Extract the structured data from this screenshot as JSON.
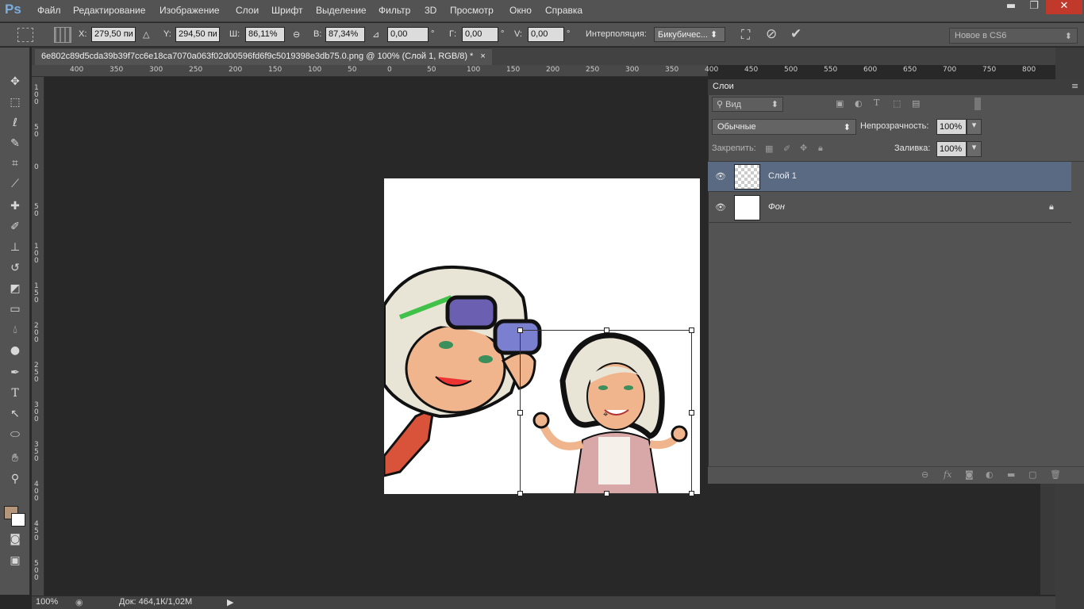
{
  "app": {
    "logo": "Ps"
  },
  "menu": [
    "Файл",
    "Редактирование",
    "Изображение",
    "Слои",
    "Шрифт",
    "Выделение",
    "Фильтр",
    "3D",
    "Просмотр",
    "Окно",
    "Справка"
  ],
  "window_controls": {
    "minimize": "▬",
    "restore": "❐",
    "close": "✕"
  },
  "options": {
    "x_label": "X:",
    "x_value": "279,50 пи",
    "y_label": "Y:",
    "y_value": "294,50 пи",
    "w_label": "Ш:",
    "w_value": "86,11%",
    "h_label": "В:",
    "h_value": "87,34%",
    "angle_value": "0,00",
    "angle_unit": "°",
    "hskew_label": "Г:",
    "hskew_value": "0,00",
    "hskew_unit": "°",
    "vskew_label": "V:",
    "vskew_value": "0,00",
    "vskew_unit": "°",
    "interp_label": "Интерполяция:",
    "interp_value": "Бикубичес...",
    "workspace": "Новое в CS6"
  },
  "document_tab": {
    "title": "6e802c89d5cda39b39f7cc6e18ca7070a063f02d00596fd6f9c5019398e3db75.0.png @ 100% (Слой 1, RGB/8) *",
    "close": "×"
  },
  "ruler_top": [
    "400",
    "350",
    "300",
    "250",
    "200",
    "150",
    "100",
    "50",
    "0",
    "50",
    "100",
    "150",
    "200",
    "250",
    "300",
    "350",
    "400",
    "450",
    "500",
    "550",
    "600",
    "650",
    "700",
    "750",
    "800",
    "850"
  ],
  "ruler_left": [
    "1 0 0",
    "5 0",
    "0",
    "5 0",
    "1 0 0",
    "1 5 0",
    "2 0 0",
    "2 5 0",
    "3 0 0",
    "3 5 0",
    "4 0 0",
    "4 5 0",
    "5 0 0"
  ],
  "layers_panel": {
    "title": "Слои",
    "filter_label": "Вид",
    "blend_mode": "Обычные",
    "opacity_label": "Непрозрачность:",
    "opacity_value": "100%",
    "lock_label": "Закрепить:",
    "fill_label": "Заливка:",
    "fill_value": "100%",
    "layers": [
      {
        "name": "Слой 1",
        "selected": true
      },
      {
        "name": "Фон",
        "selected": false,
        "locked": true
      }
    ]
  },
  "status": {
    "zoom": "100%",
    "doc_info": "Док: 464,1К/1,02М"
  },
  "colors": {
    "foreground": "#b5967a",
    "background": "#ffffff",
    "selected_layer": "#5a6a82"
  }
}
